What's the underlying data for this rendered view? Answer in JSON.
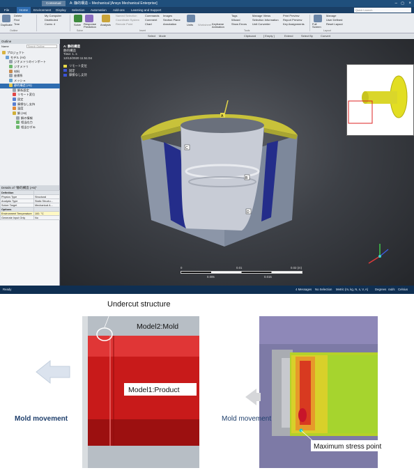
{
  "window": {
    "context_tab": "Contextual",
    "title": "A: 静的構造 – Mechanical [Ansys Mechanical Enterprise]",
    "file_tab": "File",
    "tabs": [
      "Home",
      "Environment",
      "Display",
      "Selection",
      "Automation",
      "Add-ons",
      "Learning and Support"
    ],
    "search_placeholder": "Quick Launch"
  },
  "ribbon": {
    "items": {
      "duplicate": "Duplicate",
      "delete": "Delete",
      "find": "Find",
      "tree": "Tree",
      "my_computer": "My Computer",
      "distributed": "Distributed",
      "cores": "Cores: 4",
      "solve": "Solve",
      "response_prediction": "Response Prediction",
      "analysis": "Analysis",
      "named_selection": "Named Selection",
      "coordinate_system": "Coordinate System",
      "remote_point": "Remote Point",
      "commands": "Commands",
      "comment": "Comment",
      "chart": "Chart",
      "images": "Images",
      "section_plane": "Section Plane",
      "annotation": "Annotation",
      "units": "Units",
      "worksheet": "Worksheet",
      "keyframe_animation": "Keyframe Animation",
      "tags": "Tags",
      "wizard": "Wizard",
      "show_errors": "Show Errors",
      "manage_views": "Manage Views",
      "selection_information": "Selection Information",
      "unit_converter": "Unit Converter",
      "print_preview": "Print Preview",
      "report_preview": "Report Preview",
      "key_assignments": "Key Assignments",
      "full_screen": "Full Screen",
      "manage": "Manage",
      "user_defined": "User Defined",
      "reset_layout": "Reset Layout"
    },
    "groups": {
      "outline": "Outline",
      "solve": "Solve",
      "insert": "Insert",
      "tools": "Tools",
      "layout": "Layout"
    }
  },
  "toolbar2": {
    "select": "Select",
    "mode": "Mode",
    "clipboard": "Clipboard",
    "empty": "[ Empty ]",
    "extend": "Extend",
    "select_by": "Select By",
    "convert": "Convert"
  },
  "outline": {
    "title": "Outline",
    "name_header": "Name",
    "search_placeholder": "Search Outline",
    "nodes": [
      {
        "label": "プロジェクト",
        "indent": 0,
        "color": "#d8b340"
      },
      {
        "label": "モデル (A4)",
        "indent": 1,
        "color": "#6aa0d8"
      },
      {
        "label": "ジオメトリのインポート",
        "indent": 2,
        "color": "#9aa3ad"
      },
      {
        "label": "ジオメトリ",
        "indent": 2,
        "color": "#6cb86c"
      },
      {
        "label": "材料",
        "indent": 2,
        "color": "#c78a4f"
      },
      {
        "label": "座標系",
        "indent": 2,
        "color": "#9aa3ad"
      },
      {
        "label": "メッシュ",
        "indent": 2,
        "color": "#63a3d1"
      },
      {
        "label": "静的構造 (A5)",
        "indent": 2,
        "color": "#e2c64d",
        "selected": true
      },
      {
        "label": "解析設定",
        "indent": 3,
        "color": "#9aa3ad"
      },
      {
        "label": "リモート変位",
        "indent": 3,
        "color": "#e04747"
      },
      {
        "label": "固定",
        "indent": 3,
        "color": "#5a7fd0"
      },
      {
        "label": "摩擦なし支持",
        "indent": 3,
        "color": "#5a7fd0"
      },
      {
        "label": "温度",
        "indent": 3,
        "color": "#e08a3a"
      },
      {
        "label": "解 (A6)",
        "indent": 3,
        "color": "#d0b03a"
      },
      {
        "label": "解の情報",
        "indent": 4,
        "color": "#9aa3ad"
      },
      {
        "label": "相当応力",
        "indent": 4,
        "color": "#6cb86c"
      },
      {
        "label": "相当ひずみ",
        "indent": 4,
        "color": "#6cb86c"
      }
    ]
  },
  "details": {
    "title": "Details of \"静的構造 (A5)\"",
    "rows": [
      {
        "label": "Definition",
        "value": "",
        "kind": "sec"
      },
      {
        "label": "Physics Type",
        "value": "Structural",
        "kind": ""
      },
      {
        "label": "Analysis Type",
        "value": "Static Structu...",
        "kind": ""
      },
      {
        "label": "Solver Target",
        "value": "Mechanical A...",
        "kind": ""
      },
      {
        "label": "Options",
        "value": "",
        "kind": "sec"
      },
      {
        "label": "Environment Temperature",
        "value": "100. °C",
        "kind": "hl"
      },
      {
        "label": "Generate Input Only",
        "value": "No",
        "kind": ""
      }
    ]
  },
  "viewport": {
    "title": "A: 静的構造",
    "subtitle": "静的構造",
    "time": "Time: 1. s",
    "date": "12/12/2020 11:51:04",
    "legend": [
      {
        "label": "リモート変位",
        "color": "#e6d94a"
      },
      {
        "label": "固定",
        "color": "#3b53d6"
      },
      {
        "label": "摩擦なし支持",
        "color": "#3b53d6"
      }
    ],
    "markers": [
      "A",
      "B",
      "C",
      "D"
    ],
    "scale_top": [
      "0",
      "0.01",
      "0.02 (m)"
    ],
    "scale_bottom": [
      "0.005",
      "0.015"
    ]
  },
  "statusbar": {
    "ready": "Ready",
    "messages": "4 Messages",
    "selection": "No Selection",
    "units": "Metric (m, kg, N, s, V, A)",
    "degrees": "Degrees",
    "rads": "rad/s",
    "celsius": "Celsius"
  },
  "figure": {
    "undercut": "Undercut  structure",
    "model2": "Model2:Mold",
    "model1": "Model1:Product",
    "mold_movement": "Mold movement",
    "mold_movement_right": "Mold movement",
    "max_stress": "Maximum stress point"
  }
}
